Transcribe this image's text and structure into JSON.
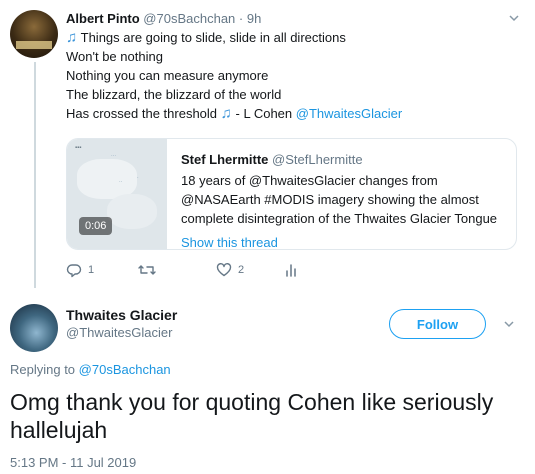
{
  "parent_tweet": {
    "name": "Albert Pinto",
    "handle": "@70sBachchan",
    "time": "· 9h",
    "lines": [
      {
        "pre": "",
        "text": "Things are going to slide, slide in all directions"
      },
      {
        "text": "Won't be nothing"
      },
      {
        "text": "Nothing you can measure anymore"
      },
      {
        "text": "The blizzard, the blizzard of the world"
      },
      {
        "text": "Has crossed the threshold",
        "post": "- L Cohen",
        "mention": "@ThwaitesGlacier"
      }
    ],
    "quote": {
      "video_time": "0:06",
      "name": "Stef Lhermitte",
      "handle": "@StefLhermitte",
      "text": "18 years of @ThwaitesGlacier changes from @NASAEarth #MODIS imagery showing the almost complete disintegration of the Thwaites Glacier Tongue",
      "show_thread": "Show this thread"
    },
    "actions": {
      "reply_count": "1",
      "retweet_count": "",
      "like_count": "2"
    }
  },
  "main_tweet": {
    "name": "Thwaites Glacier",
    "handle": "@ThwaitesGlacier",
    "follow_label": "Follow",
    "replying_prefix": "Replying to",
    "replying_to": "@70sBachchan",
    "text": "Omg thank you for quoting Cohen like seriously hallelujah",
    "timestamp": "5:13 PM - 11 Jul 2019"
  },
  "colors": {
    "link": "#1b95e0",
    "muted": "#657786",
    "follow": "#1da1f2"
  }
}
